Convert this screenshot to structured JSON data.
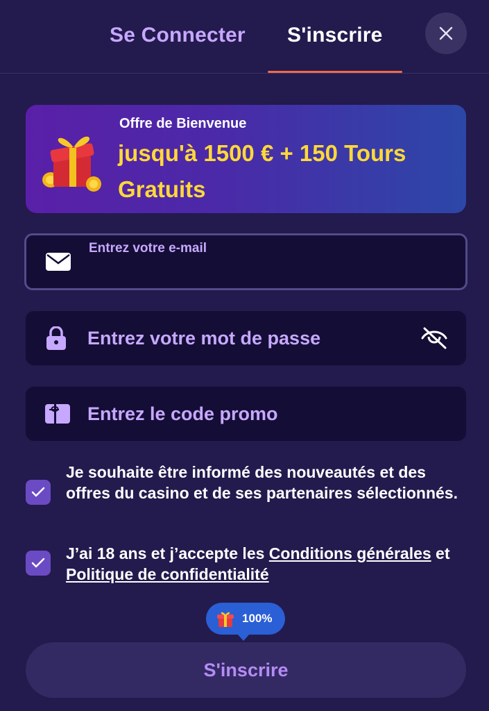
{
  "tabs": {
    "login_label": "Se Connecter",
    "register_label": "S'inscrire",
    "active": "register"
  },
  "close_icon": "close-icon",
  "banner": {
    "label": "Offre de Bienvenue",
    "offer": "jusqu'à 1500 € + 150 Tours Gratuits",
    "icon": "gift-icon"
  },
  "form": {
    "email": {
      "label": "Entrez votre e-mail",
      "value": "",
      "icon": "envelope-icon"
    },
    "password": {
      "placeholder": "Entrez votre mot de passe",
      "value": "",
      "icon": "lock-icon",
      "toggle_icon": "eye-slash-icon"
    },
    "promo": {
      "placeholder": "Entrez le code promo",
      "value": "",
      "icon": "ticket-icon"
    }
  },
  "consents": {
    "newsletter": {
      "checked": true,
      "text": "Je souhaite être informé des nouveautés et des offres du casino et de ses partenaires sélectionnés."
    },
    "terms": {
      "checked": true,
      "prefix": "J’ai 18 ans et j’accepte les ",
      "terms_link": "Conditions générales",
      "conjunction": " et ",
      "privacy_link": "Politique de confidentialité"
    }
  },
  "bonus_progress": {
    "label": "100%",
    "value": 1.0
  },
  "submit_label": "S'inscrire",
  "colors": {
    "background": "#231a4d",
    "accent_tab": "#c7a8ff",
    "underline": "#ef6b45",
    "offer_text": "#ffd83a",
    "checkbox": "#6b4bc4",
    "progress_bubble": "#2a5fd6"
  }
}
